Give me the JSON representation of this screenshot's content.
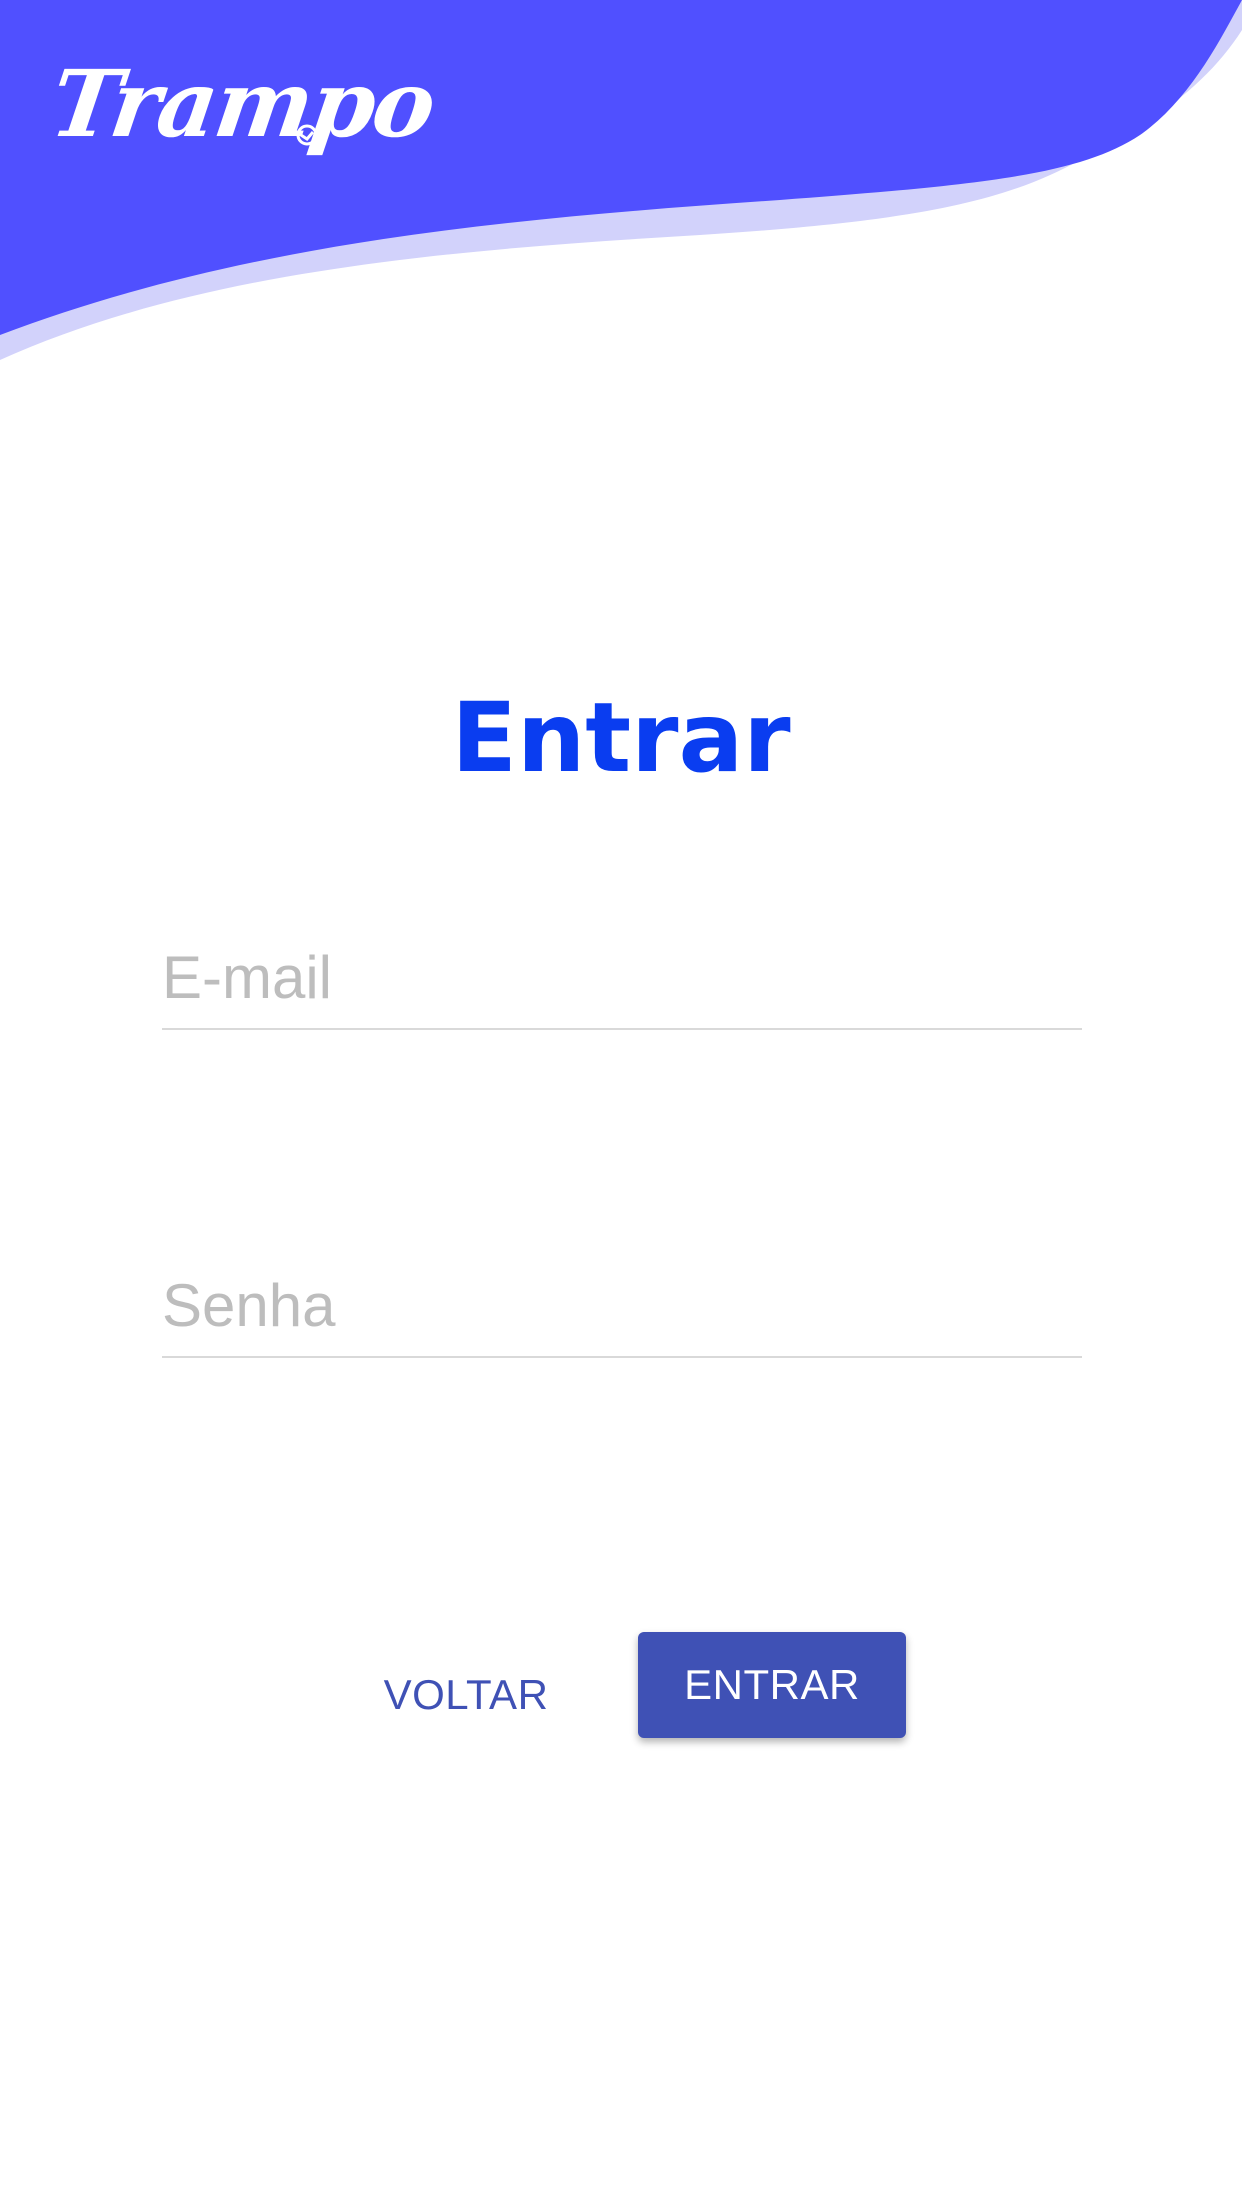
{
  "header": {
    "logo_text": "Trampo",
    "colors": {
      "primary": "#5050ff",
      "wave_shadow": "#d2d2fb"
    }
  },
  "login": {
    "title": "Entrar",
    "email_placeholder": "E-mail",
    "password_placeholder": "Senha",
    "back_label": "VOLTAR",
    "submit_label": "ENTRAR",
    "colors": {
      "title": "#0a3df0",
      "button": "#3f51b5"
    }
  }
}
